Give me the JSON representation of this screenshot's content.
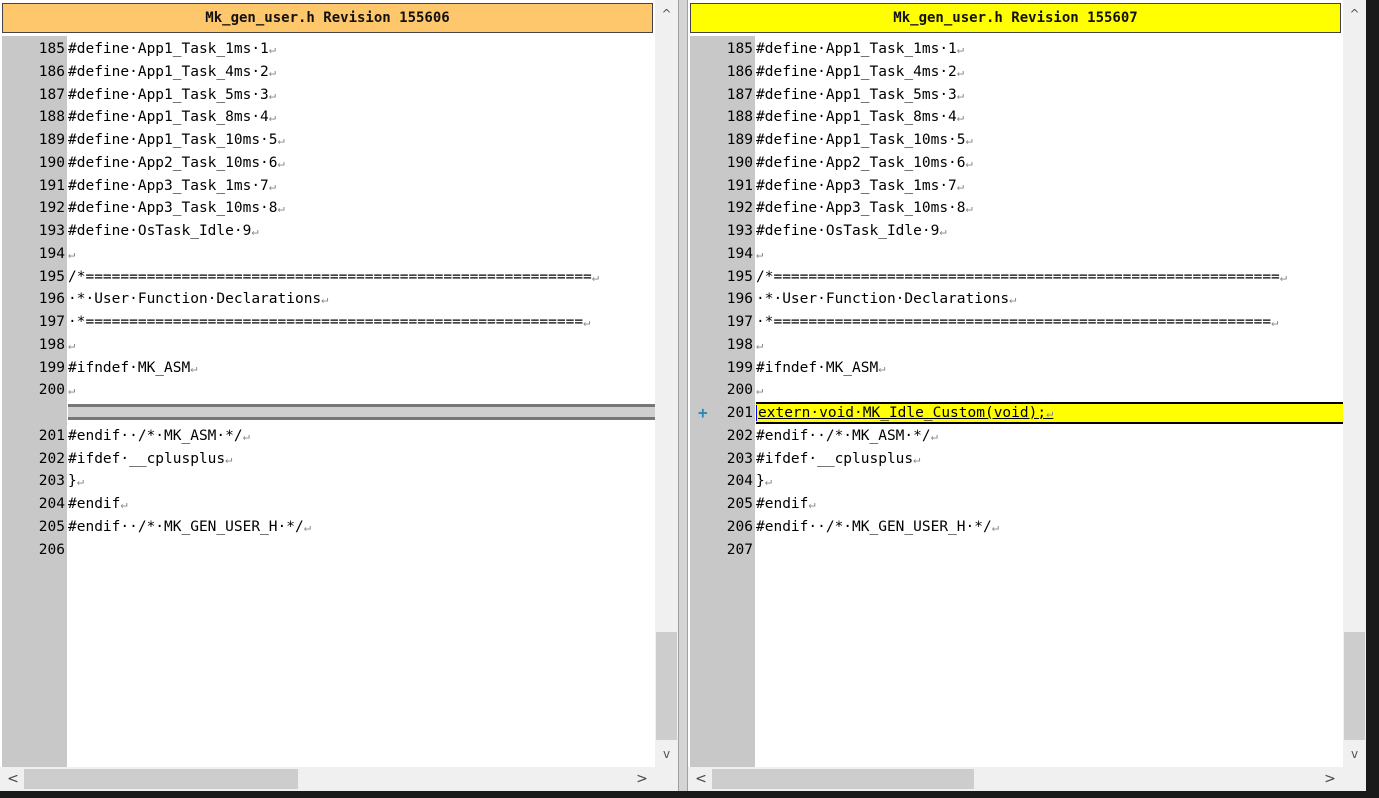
{
  "left": {
    "title": "Mk_gen_user.h Revision 155606",
    "lines": [
      {
        "n": "185",
        "t": "#define·App1_Task_1ms·1"
      },
      {
        "n": "186",
        "t": "#define·App1_Task_4ms·2"
      },
      {
        "n": "187",
        "t": "#define·App1_Task_5ms·3"
      },
      {
        "n": "188",
        "t": "#define·App1_Task_8ms·4"
      },
      {
        "n": "189",
        "t": "#define·App1_Task_10ms·5"
      },
      {
        "n": "190",
        "t": "#define·App2_Task_10ms·6"
      },
      {
        "n": "191",
        "t": "#define·App3_Task_1ms·7"
      },
      {
        "n": "192",
        "t": "#define·App3_Task_10ms·8"
      },
      {
        "n": "193",
        "t": "#define·OsTask_Idle·9"
      },
      {
        "n": "194",
        "t": ""
      },
      {
        "n": "195",
        "t": "/*=========================================================="
      },
      {
        "n": "196",
        "t": "·*·User·Function·Declarations"
      },
      {
        "n": "197",
        "t": "·*========================================================="
      },
      {
        "n": "198",
        "t": ""
      },
      {
        "n": "199",
        "t": "#ifndef·MK_ASM"
      },
      {
        "n": "200",
        "t": ""
      },
      {
        "n": "",
        "t": "",
        "sep": true
      },
      {
        "n": "201",
        "t": "#endif··/*·MK_ASM·*/"
      },
      {
        "n": "202",
        "t": "#ifdef·__cplusplus"
      },
      {
        "n": "203",
        "t": "}"
      },
      {
        "n": "204",
        "t": "#endif"
      },
      {
        "n": "205",
        "t": "#endif··/*·MK_GEN_USER_H·*/"
      },
      {
        "n": "206",
        "t": "",
        "noret": true
      }
    ]
  },
  "right": {
    "title": "Mk_gen_user.h Revision 155607",
    "lines": [
      {
        "n": "185",
        "t": "#define·App1_Task_1ms·1"
      },
      {
        "n": "186",
        "t": "#define·App1_Task_4ms·2"
      },
      {
        "n": "187",
        "t": "#define·App1_Task_5ms·3"
      },
      {
        "n": "188",
        "t": "#define·App1_Task_8ms·4"
      },
      {
        "n": "189",
        "t": "#define·App1_Task_10ms·5"
      },
      {
        "n": "190",
        "t": "#define·App2_Task_10ms·6"
      },
      {
        "n": "191",
        "t": "#define·App3_Task_1ms·7"
      },
      {
        "n": "192",
        "t": "#define·App3_Task_10ms·8"
      },
      {
        "n": "193",
        "t": "#define·OsTask_Idle·9"
      },
      {
        "n": "194",
        "t": ""
      },
      {
        "n": "195",
        "t": "/*=========================================================="
      },
      {
        "n": "196",
        "t": "·*·User·Function·Declarations"
      },
      {
        "n": "197",
        "t": "·*========================================================="
      },
      {
        "n": "198",
        "t": ""
      },
      {
        "n": "199",
        "t": "#ifndef·MK_ASM"
      },
      {
        "n": "200",
        "t": ""
      },
      {
        "n": "201",
        "t": "extern·void·MK_Idle_Custom(void);",
        "added": true,
        "marker": "+"
      },
      {
        "n": "202",
        "t": "#endif··/*·MK_ASM·*/"
      },
      {
        "n": "203",
        "t": "#ifdef·__cplusplus"
      },
      {
        "n": "204",
        "t": "}"
      },
      {
        "n": "205",
        "t": "#endif"
      },
      {
        "n": "206",
        "t": "#endif··/*·MK_GEN_USER_H·*/"
      },
      {
        "n": "207",
        "t": "",
        "noret": true
      }
    ]
  },
  "glyphs": {
    "return": "↵",
    "scroll_up": "^",
    "scroll_down": "v",
    "scroll_left": "<",
    "scroll_right": ">"
  },
  "colors": {
    "left_title_bg": "#ffc76b",
    "right_title_bg": "#ffff00",
    "added_line_bg": "#ffff00",
    "added_marker": "#2a8ab8"
  }
}
